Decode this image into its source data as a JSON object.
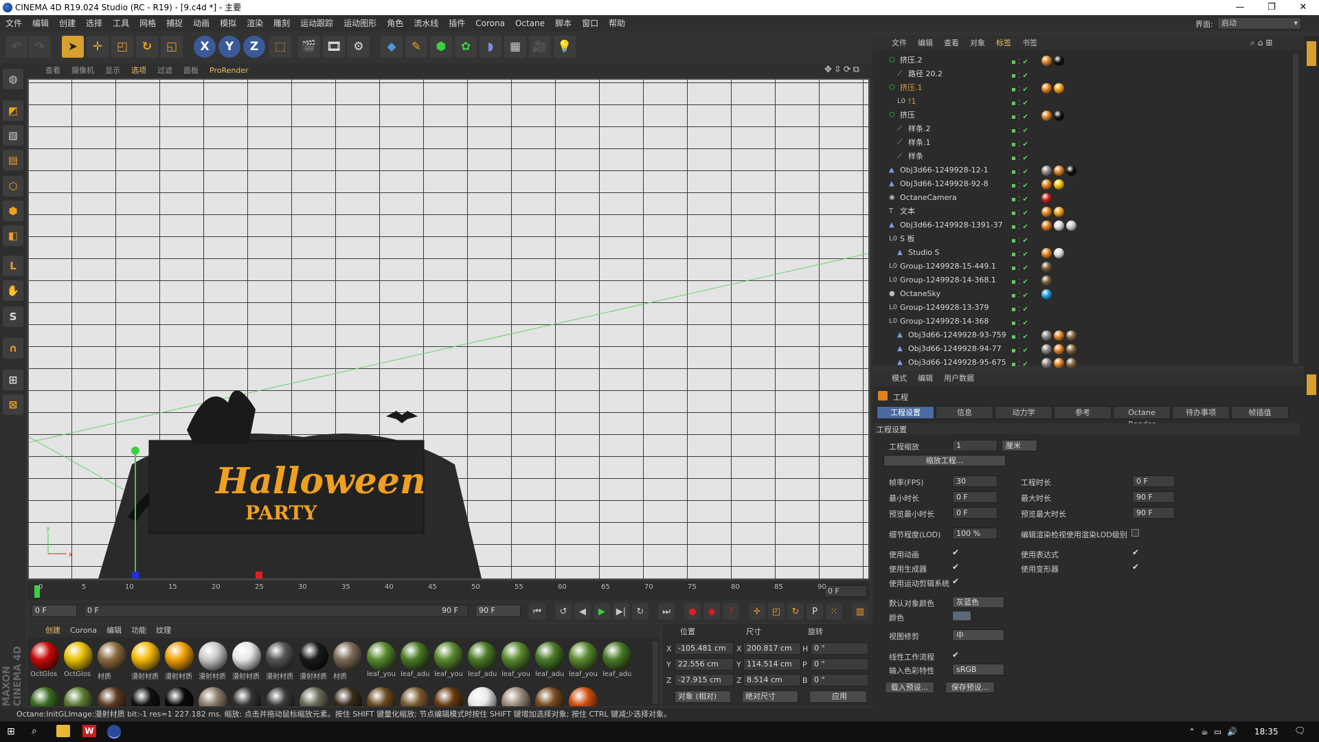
{
  "title": "CINEMA 4D R19.024 Studio (RC - R19) - [9.c4d *] - 主要",
  "window_controls": [
    "—",
    "❐",
    "✕"
  ],
  "menu": [
    "文件",
    "编辑",
    "创建",
    "选择",
    "工具",
    "网格",
    "捕捉",
    "动画",
    "模拟",
    "渲染",
    "雕刻",
    "运动跟踪",
    "运动图形",
    "角色",
    "流水线",
    "插件",
    "Corona",
    "Octane",
    "脚本",
    "窗口",
    "帮助"
  ],
  "layout": {
    "label": "界面:",
    "value": "启动"
  },
  "toolbar": {
    "x": "X",
    "y": "Y",
    "z": "Z"
  },
  "viewport_menu": [
    "查看",
    "摄像机",
    "显示",
    "选项",
    "过滤",
    "面板",
    "ProRender"
  ],
  "viewport": {
    "sign_top": "Halloween",
    "sign_bottom": "PARTY",
    "axis_x": "x",
    "axis_y": "y"
  },
  "timeline": {
    "ticks": [
      "0",
      "5",
      "10",
      "15",
      "20",
      "25",
      "30",
      "35",
      "40",
      "45",
      "50",
      "55",
      "60",
      "65",
      "70",
      "75",
      "80",
      "85",
      "90"
    ],
    "current": "0 F"
  },
  "transport": {
    "start": "0 F",
    "range_start": "0 F",
    "range_end": "90 F",
    "end": "90 F"
  },
  "material_menu": [
    "创建",
    "Corona",
    "编辑",
    "功能",
    "纹理"
  ],
  "materials": [
    {
      "label": "OctGlos",
      "color": "#c80a0a"
    },
    {
      "label": "OctGlos",
      "color": "#e8c000"
    },
    {
      "label": "材质",
      "color": "#8a6a40"
    },
    {
      "label": "漫射材质",
      "color": "#f5b800"
    },
    {
      "label": "漫射材质",
      "color": "#f0a000"
    },
    {
      "label": "漫射材质",
      "color": "#c8c8c8"
    },
    {
      "label": "漫射材质",
      "color": "#e8e8e8"
    },
    {
      "label": "漫射材质",
      "color": "#555555"
    },
    {
      "label": "漫射材质",
      "color": "#1a1a1a"
    },
    {
      "label": "材质",
      "color": "#7a6a55"
    },
    {
      "label": "leaf_you",
      "color": "#5a8a30"
    },
    {
      "label": "leaf_adu",
      "color": "#4a7a28"
    },
    {
      "label": "leaf_you",
      "color": "#5a8a30"
    },
    {
      "label": "leaf_adu",
      "color": "#4a7a28"
    },
    {
      "label": "leaf_you",
      "color": "#5a8a30"
    },
    {
      "label": "leaf_adu",
      "color": "#4a7a28"
    },
    {
      "label": "leaf_you",
      "color": "#5a8a30"
    },
    {
      "label": "leaf_adu",
      "color": "#4a7a28"
    }
  ],
  "materials_row2": [
    "#3a6a20",
    "#5a7a30",
    "#5a3a20",
    "#111111",
    "#0a0a0a",
    "#8a7a6a",
    "#333333",
    "#3a3a3a",
    "#6a6a5a",
    "#3a2a1a",
    "#6a4a20",
    "#7a5a30",
    "#6a3a10",
    "#e8e8e8",
    "#9a8a7a",
    "#7a4a20",
    "#d05010"
  ],
  "coords": {
    "pos": "位置",
    "size": "尺寸",
    "rot": "旋转",
    "x": "-105.481 cm",
    "y": "22.556 cm",
    "z": "-27.915 cm",
    "sx": "200.817 cm",
    "sy": "114.514 cm",
    "sz": "8.514 cm",
    "h": "0 °",
    "p": "0 °",
    "b": "0 °",
    "mode": "对象 (相对)",
    "size_mode": "绝对尺寸",
    "apply": "应用",
    "lx": "X",
    "ly": "Y",
    "lz": "Z",
    "lsx": "X",
    "lsy": "Y",
    "lsz": "Z",
    "lh": "H",
    "lp": "P",
    "lb": "B"
  },
  "status": "Octane:InitGLImage:漫射材质 bit:-1 res=1 227.182 ms.   缩放: 点击并拖动鼠标缩放元素。按住 SHIFT 键量化缩放; 节点编辑模式时按住 SHIFT 键增加选择对象; 按住 CTRL 键减少选择对象。",
  "object_menu": [
    "文件",
    "编辑",
    "查看",
    "对象",
    "标签",
    "书签"
  ],
  "objects": [
    {
      "name": "挤压.2",
      "indent": 0,
      "icon": "⬡",
      "color": "#d8d8d8",
      "tags": [
        "#e08020",
        "#111"
      ]
    },
    {
      "name": "路径 20.2",
      "indent": 1,
      "icon": "⟋",
      "color": "#d8d8d8",
      "tags": []
    },
    {
      "name": "挤压.1",
      "indent": 0,
      "icon": "⬡",
      "color": "#e8a030",
      "tags": [
        "#e08020",
        "#f0a010"
      ]
    },
    {
      "name": "!1",
      "indent": 1,
      "icon": "L0",
      "color": "#e8a030",
      "tags": []
    },
    {
      "name": "挤压",
      "indent": 0,
      "icon": "⬡",
      "color": "#d8d8d8",
      "tags": [
        "#e08020",
        "#111"
      ]
    },
    {
      "name": "样条.2",
      "indent": 1,
      "icon": "⟋",
      "color": "#d8d8d8",
      "tags": []
    },
    {
      "name": "样条.1",
      "indent": 1,
      "icon": "⟋",
      "color": "#d8d8d8",
      "tags": []
    },
    {
      "name": "样条",
      "indent": 1,
      "icon": "⟋",
      "color": "#d8d8d8",
      "tags": []
    },
    {
      "name": "Obj3d66-1249928-12-1",
      "indent": 0,
      "icon": "▲",
      "color": "#d8d8d8",
      "tags": [
        "#888",
        "#e08020",
        "#111"
      ]
    },
    {
      "name": "Obj3d66-1249928-92-8",
      "indent": 0,
      "icon": "▲",
      "color": "#d8d8d8",
      "tags": [
        "#e08020",
        "#f0c000"
      ]
    },
    {
      "name": "OctaneCamera",
      "indent": 0,
      "icon": "◉",
      "color": "#d8d8d8",
      "tags": [
        "#d02020"
      ]
    },
    {
      "name": "文本",
      "indent": 0,
      "icon": "T",
      "color": "#d8d8d8",
      "tags": [
        "#e08020",
        "#f0a010"
      ]
    },
    {
      "name": "Obj3d66-1249928-1391-37",
      "indent": 0,
      "icon": "▲",
      "color": "#d8d8d8",
      "tags": [
        "#e08020",
        "#ddd",
        "#ccc"
      ]
    },
    {
      "name": "S 板",
      "indent": 0,
      "icon": "L0",
      "color": "#d8d8d8",
      "tags": []
    },
    {
      "name": "Studio S",
      "indent": 1,
      "icon": "▲",
      "color": "#d8d8d8",
      "tags": [
        "#e08020",
        "#ddd"
      ]
    },
    {
      "name": "Group-1249928-15-449.1",
      "indent": 0,
      "icon": "L0",
      "color": "#d8d8d8",
      "tags": [
        "#7a6040"
      ]
    },
    {
      "name": "Group-1249928-14-368.1",
      "indent": 0,
      "icon": "L0",
      "color": "#d8d8d8",
      "tags": [
        "#7a6040"
      ]
    },
    {
      "name": "OctaneSky",
      "indent": 0,
      "icon": "●",
      "color": "#d8d8d8",
      "tags": [
        "#20a0e0"
      ]
    },
    {
      "name": "Group-1249928-13-379",
      "indent": 0,
      "icon": "L0",
      "color": "#d8d8d8",
      "tags": []
    },
    {
      "name": "Group-1249928-14-368",
      "indent": 0,
      "icon": "L0",
      "color": "#d8d8d8",
      "tags": []
    },
    {
      "name": "Obj3d66-1249928-93-759",
      "indent": 1,
      "icon": "▲",
      "color": "#d8d8d8",
      "tags": [
        "#888",
        "#e08020",
        "#8a6a40"
      ]
    },
    {
      "name": "Obj3d66-1249928-94-77",
      "indent": 1,
      "icon": "▲",
      "color": "#d8d8d8",
      "tags": [
        "#888",
        "#e08020",
        "#8a6a40"
      ]
    },
    {
      "name": "Obj3d66-1249928-95-675",
      "indent": 1,
      "icon": "▲",
      "color": "#d8d8d8",
      "tags": [
        "#888",
        "#e08020",
        "#8a6a40"
      ]
    }
  ],
  "attr_menu": [
    "模式",
    "编辑",
    "用户数据"
  ],
  "attr": {
    "title": "工程",
    "tabs": [
      "工程设置",
      "信息",
      "动力学",
      "参考",
      "Octane Render",
      "待办事项",
      "帧插值"
    ],
    "section": "工程设置",
    "scale_label": "工程缩放",
    "scale_value": "1",
    "scale_unit": "厘米",
    "scale_btn": "缩放工程...",
    "fps_label": "帧率(FPS)",
    "fps": "30",
    "dur_label": "工程时长",
    "dur": "0 F",
    "min_label": "最小时长",
    "min": "0 F",
    "max_label": "最大时长",
    "max": "90 F",
    "pmin_label": "预览最小时长",
    "pmin": "0 F",
    "pmax_label": "预览最大时长",
    "pmax": "90 F",
    "lod_label": "细节程度(LOD)",
    "lod": "100 %",
    "lod2_label": "编辑渲染检视使用渲染LOD级别",
    "anim_label": "使用动画",
    "expr_label": "使用表达式",
    "gen_label": "使用生成器",
    "def_label": "使用变形器",
    "mo_label": "使用运动剪辑系统",
    "objcol_label": "默认对象颜色",
    "objcol": "灰蓝色",
    "col_label": "颜色",
    "clip_label": "视图修剪",
    "clip": "中",
    "linear_label": "线性工作流程",
    "cs_label": "输入色彩特性",
    "cs": "sRGB",
    "load_btn": "载入预设...",
    "save_btn": "保存预设..."
  },
  "taskbar": {
    "time": "18:35"
  }
}
